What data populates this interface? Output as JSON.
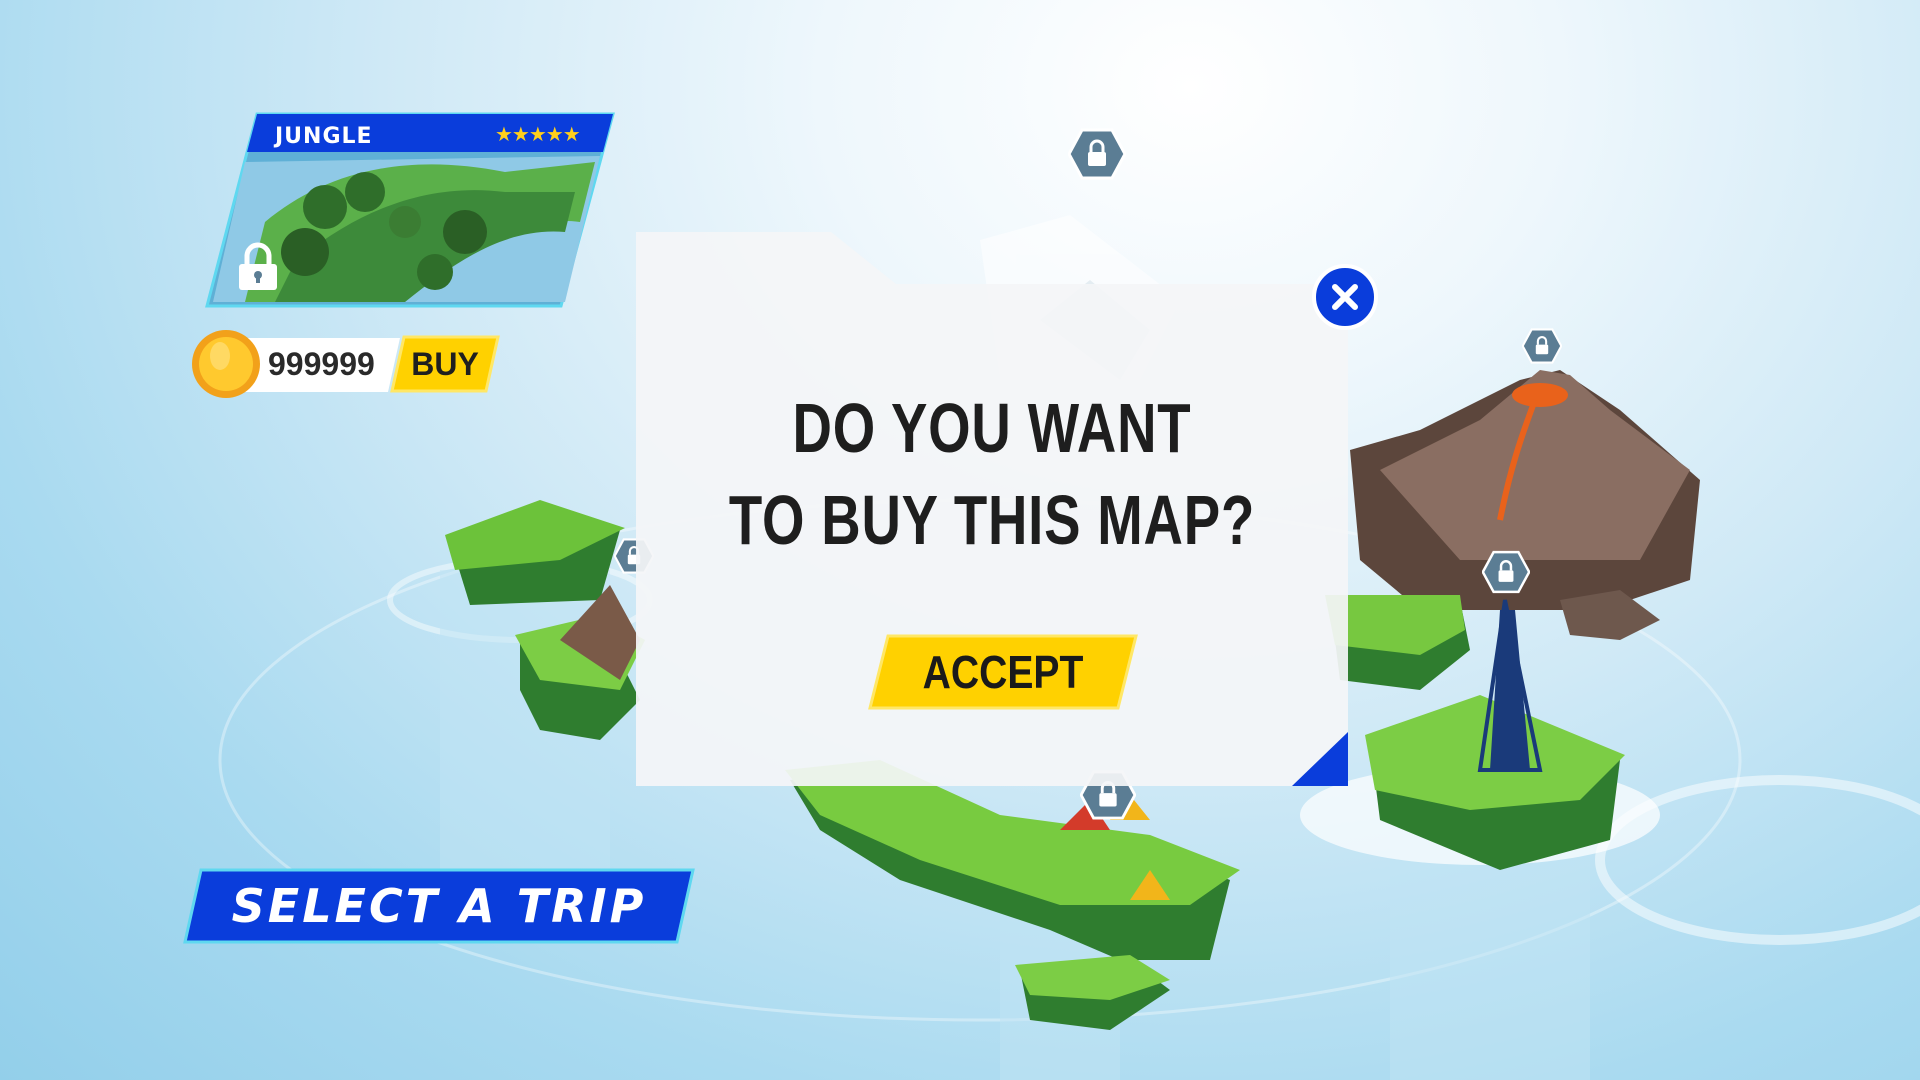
{
  "map_card": {
    "title": "JUNGLE",
    "stars": "★★★★★",
    "star_rating": 5,
    "locked": true
  },
  "wallet": {
    "coins": "999999",
    "buy_label": "BUY"
  },
  "dialog": {
    "question_line1": "DO YOU WANT",
    "question_line2": "TO BUY THIS MAP?",
    "accept_label": "ACCEPT"
  },
  "footer": {
    "select_trip_label": "SELECT A TRIP"
  },
  "icons": {
    "close": "close-icon",
    "lock": "lock-icon",
    "coin": "coin-icon"
  },
  "colors": {
    "accent_blue": "#0a3ddb",
    "button_yellow": "#ffd100",
    "dialog_bg": "#f4f5f7"
  }
}
